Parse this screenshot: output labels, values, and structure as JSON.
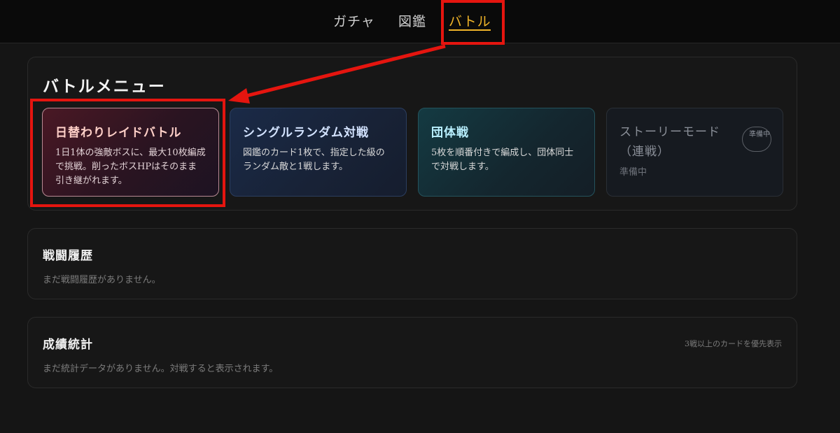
{
  "nav": {
    "tabs": [
      {
        "label": "ガチャ"
      },
      {
        "label": "図鑑"
      },
      {
        "label": "バトル"
      }
    ],
    "active_tab": "バトル",
    "accent_color": "#f0b429"
  },
  "battle_menu": {
    "title": "バトルメニュー",
    "cards": [
      {
        "title": "日替わりレイドバトル",
        "description": "1日1体の強敵ボスに、最大10枚編成で挑戦。削ったボスHPはそのまま引き継がれます。"
      },
      {
        "title": "シングルランダム対戦",
        "description": "図鑑のカード1枚で、指定した級のランダム敵と1戦します。"
      },
      {
        "title": "団体戦",
        "description": "5枚を順番付きで編成し、団体同士で対戦します。"
      },
      {
        "title": "ストーリーモード（連戦）",
        "description": "準備中",
        "badge": "準備中"
      }
    ]
  },
  "history": {
    "title": "戦闘履歴",
    "empty_text": "まだ戦闘履歴がありません。"
  },
  "stats": {
    "title": "成績統計",
    "note": "3戦以上のカードを優先表示",
    "empty_text": "まだ統計データがありません。対戦すると表示されます。"
  },
  "annotation_color": "#e5150f"
}
